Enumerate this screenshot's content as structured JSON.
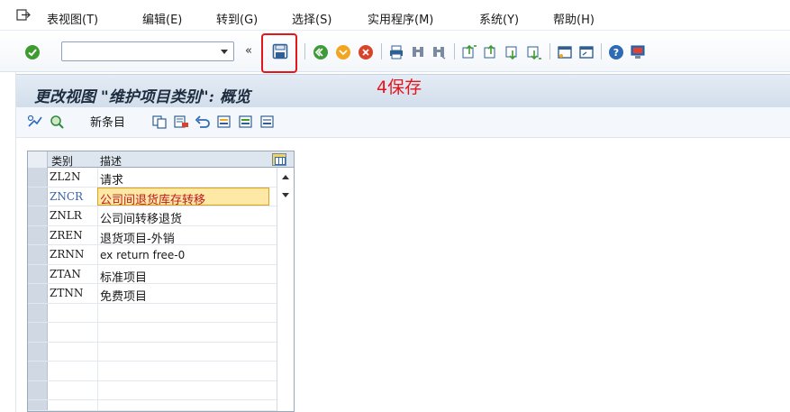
{
  "menu": {
    "items": [
      {
        "label": "表视图(T)"
      },
      {
        "label": "编辑(E)"
      },
      {
        "label": "转到(G)"
      },
      {
        "label": "选择(S)"
      },
      {
        "label": "实用程序(M)"
      },
      {
        "label": "系统(Y)"
      },
      {
        "label": "帮助(H)"
      }
    ]
  },
  "toolbar": {
    "command_field_value": "",
    "icons": [
      "enter-icon",
      "collapse-icon",
      "save-icon",
      "back-icon",
      "exit-icon",
      "cancel-icon",
      "print-icon",
      "find-icon",
      "find-next-icon",
      "first-page-icon",
      "previous-page-icon",
      "next-page-icon",
      "last-page-icon",
      "create-session-icon",
      "shortcut-icon",
      "help-icon",
      "customize-layout-icon"
    ]
  },
  "annotation": {
    "text": "4保存",
    "color": "#e4161c"
  },
  "title": {
    "text": "更改视图 \"维护项目类别\": 概览"
  },
  "app_toolbar": {
    "new_entries_label": "新条目",
    "icons": [
      "display-change-icon",
      "find-icon",
      "copy-as-icon",
      "delete-icon",
      "undo-icon",
      "select-all-icon",
      "select-block-icon",
      "deselect-all-icon"
    ]
  },
  "table": {
    "columns": [
      "类别",
      "描述"
    ],
    "rows": [
      {
        "code": "ZL2N",
        "desc": "请求",
        "selected": false
      },
      {
        "code": "ZNCR",
        "desc": "公司间退货库存转移",
        "selected": true
      },
      {
        "code": "ZNLR",
        "desc": "公司间转移退货",
        "selected": false
      },
      {
        "code": "ZREN",
        "desc": "退货项目-外销",
        "selected": false
      },
      {
        "code": "ZRNN",
        "desc": "ex return free-0",
        "selected": false
      },
      {
        "code": "ZTAN",
        "desc": "标准项目",
        "selected": false
      },
      {
        "code": "ZTNN",
        "desc": "免费项目",
        "selected": false
      },
      {
        "code": "",
        "desc": "",
        "selected": false
      },
      {
        "code": "",
        "desc": "",
        "selected": false
      },
      {
        "code": "",
        "desc": "",
        "selected": false
      },
      {
        "code": "",
        "desc": "",
        "selected": false
      },
      {
        "code": "",
        "desc": "",
        "selected": false
      },
      {
        "code": "",
        "desc": "",
        "selected": false
      }
    ]
  },
  "colors": {
    "accent": "#e4161c",
    "title_bar": "#d2deeb",
    "selected_row": "#fde8a6"
  }
}
